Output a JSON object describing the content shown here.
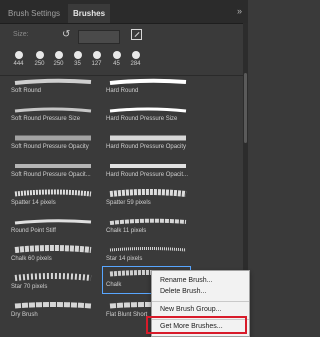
{
  "tabs": [
    "Brush Settings",
    "Brushes"
  ],
  "flyout": "»",
  "size": {
    "label": "Size:",
    "value": ""
  },
  "recent_sizes": [
    "444",
    "250",
    "250",
    "35",
    "127",
    "45",
    "284"
  ],
  "brushes": [
    {
      "left": "Soft Round",
      "right": "Hard Round"
    },
    {
      "left": "Soft Round Pressure Size",
      "right": "Hard Round Pressure Size"
    },
    {
      "left": "Soft Round Pressure Opacity",
      "right": "Hard Round Pressure Opacity"
    },
    {
      "left": "Soft Round Pressure Opacit...",
      "right": "Hard Round Pressure Opacit..."
    },
    {
      "left": "Spatter 14 pixels",
      "right": "Spatter 59 pixels"
    },
    {
      "left": "Round Point Stiff",
      "right": "Chalk 11 pixels"
    },
    {
      "left": "Chalk 60 pixels",
      "right": "Star 14 pixels"
    },
    {
      "left": "Star 70 pixels",
      "right": "Chalk"
    },
    {
      "left": "Dry Brush",
      "right": "Flat Blunt Short"
    }
  ],
  "menu": [
    "Rename Brush...",
    "Delete Brush...",
    "New Brush Group...",
    "Get More Brushes..."
  ],
  "colors": {
    "highlight": "#d81b2a",
    "selection": "#58a6ff"
  }
}
